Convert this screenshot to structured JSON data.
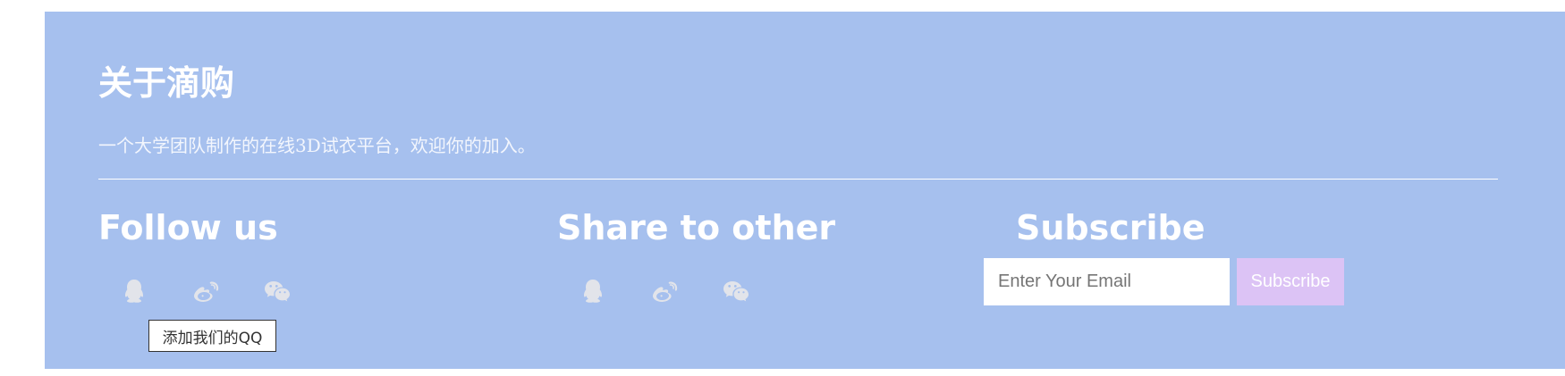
{
  "about": {
    "title": "关于滴购",
    "description": "一个大学团队制作的在线3D试衣平台，欢迎你的加入。"
  },
  "follow": {
    "title": "Follow us",
    "icons": [
      "qq-icon",
      "weibo-icon",
      "wechat-icon"
    ],
    "tooltip": "添加我们的QQ"
  },
  "share": {
    "title": "Share to other",
    "icons": [
      "qq-icon",
      "weibo-icon",
      "wechat-icon"
    ]
  },
  "subscribe": {
    "title": "Subscribe",
    "email_placeholder": "Enter Your Email",
    "button_label": "Subscribe"
  },
  "colors": {
    "background": "#a6c0ee",
    "icon": "#e2e4ea",
    "button": "#dcc3f5"
  }
}
